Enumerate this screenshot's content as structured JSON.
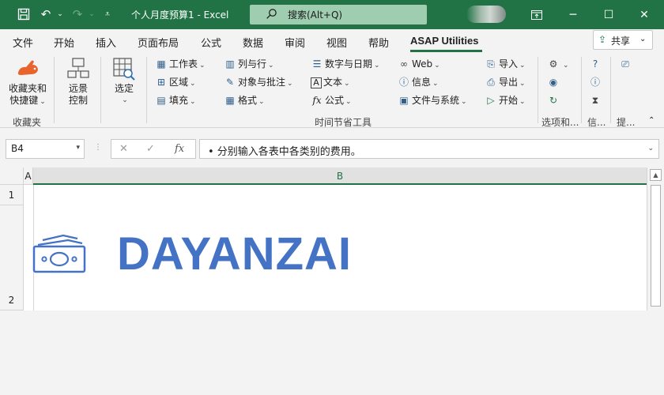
{
  "titlebar": {
    "doc_title": "个人月度预算1 - Excel",
    "search_placeholder": "搜索(Alt+Q)"
  },
  "tabs": [
    "文件",
    "开始",
    "插入",
    "页面布局",
    "公式",
    "数据",
    "审阅",
    "视图",
    "帮助",
    "ASAP Utilities"
  ],
  "active_tab": "ASAP Utilities",
  "share_label": "共享",
  "ribbon": {
    "favorites_label": "收藏夹和\n快捷键",
    "favorites_line1": "收藏夹和",
    "favorites_line2": "快捷键",
    "group_favorites": "收藏夹",
    "remote_line1": "远景",
    "remote_line2": "控制",
    "select_label": "选定",
    "col1": [
      "工作表",
      "区域",
      "填充"
    ],
    "col2": [
      "列与行",
      "对象与批注",
      "格式"
    ],
    "col3": [
      "数字与日期",
      "文本",
      "公式"
    ],
    "col4": [
      "Web",
      "信息",
      "文件与系统"
    ],
    "col5": [
      "导入",
      "导出",
      "开始"
    ],
    "group_time_tools": "时间节省工具",
    "group_options": "选项和...",
    "group_info": "信...",
    "group_tips": "提..."
  },
  "formula_bar": {
    "name_box": "B4",
    "cancel": "✕",
    "enter": "✓",
    "fx": "fx",
    "content": "• 分别输入各表中各类别的费用。"
  },
  "sheet": {
    "col_headers": [
      "A",
      "B"
    ],
    "row_headers": [
      "1",
      "2"
    ],
    "logo_text": "DAYANZAI"
  },
  "colors": {
    "excel_green": "#217346",
    "logo_blue": "#4472c4"
  }
}
